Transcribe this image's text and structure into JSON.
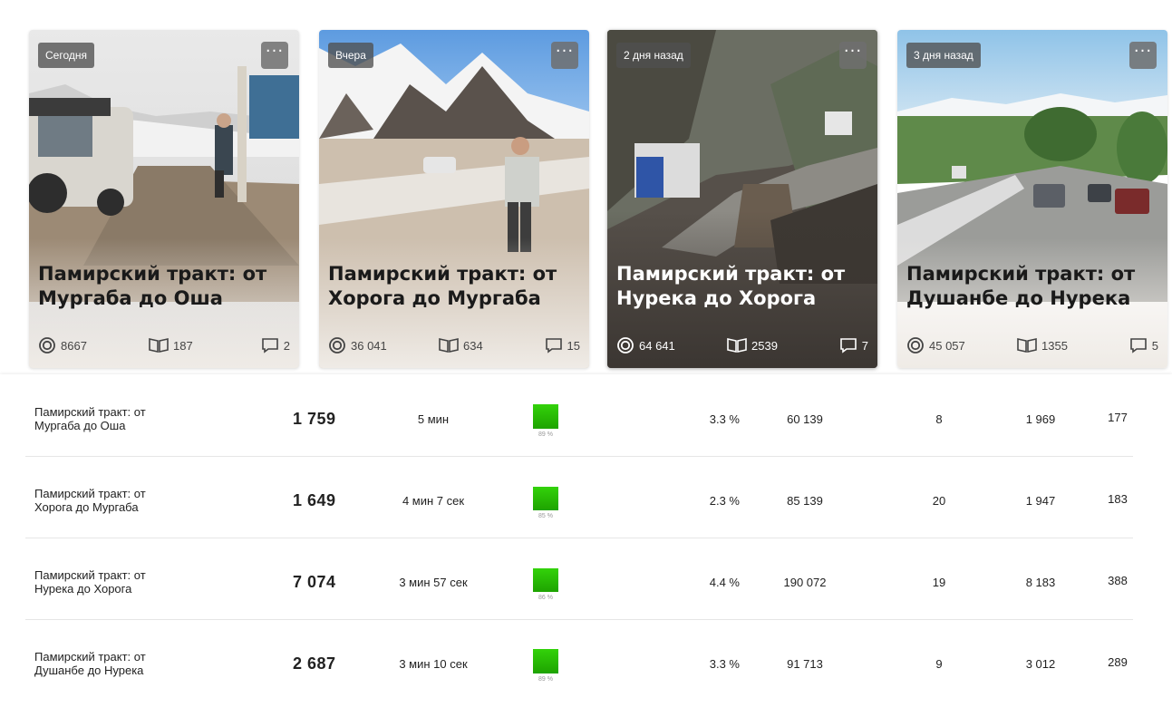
{
  "cards": [
    {
      "badge": "Сегодня",
      "title": "Памирский тракт: от Мургаба до Оша",
      "views": "8667",
      "reads": "187",
      "comments": "2"
    },
    {
      "badge": "Вчера",
      "title": "Памирский тракт: от Хорога до Мургаба",
      "views": "36 041",
      "reads": "634",
      "comments": "15"
    },
    {
      "badge": "2 дня назад",
      "title": "Памирский тракт: от Нурека до Хорога",
      "views": "64 641",
      "reads": "2539",
      "comments": "7"
    },
    {
      "badge": "3 дня назад",
      "title": "Памирский тракт: от Душанбе до Нурека",
      "views": "45 057",
      "reads": "1355",
      "comments": "5"
    }
  ],
  "more_label": "···",
  "rows": [
    {
      "title_line1": "Памирский тракт: от",
      "title_line2": "Мургаба до Оша",
      "views": "1 759",
      "time": "5 мин",
      "bar_pct": "89 %",
      "bar_value": 0.89,
      "ctr": "3.3 %",
      "shows": "60 139",
      "subs": "8",
      "clicks": "1 969",
      "last": "177"
    },
    {
      "title_line1": "Памирский тракт: от",
      "title_line2": "Хорога до Мургаба",
      "views": "1 649",
      "time": "4 мин 7 сек",
      "bar_pct": "85 %",
      "bar_value": 0.85,
      "ctr": "2.3 %",
      "shows": "85 139",
      "subs": "20",
      "clicks": "1 947",
      "last": "183"
    },
    {
      "title_line1": "Памирский тракт: от",
      "title_line2": "Нурека до Хорога",
      "views": "7 074",
      "time": "3 мин 57 сек",
      "bar_pct": "86 %",
      "bar_value": 0.86,
      "ctr": "4.4 %",
      "shows": "190 072",
      "subs": "19",
      "clicks": "8 183",
      "last": "388"
    },
    {
      "title_line1": "Памирский тракт: от",
      "title_line2": "Душанбе до Нурека",
      "views": "2 687",
      "time": "3 мин 10 сек",
      "bar_pct": "89 %",
      "bar_value": 0.89,
      "ctr": "3.3 %",
      "shows": "91 713",
      "subs": "9",
      "clicks": "3 012",
      "last": "289"
    }
  ],
  "icons": {
    "views": "eye-icon",
    "reads": "book-icon",
    "comments": "comment-icon",
    "more": "more-dots-icon"
  },
  "colors": {
    "bar": "#22b004",
    "badge_bg": "#5a5a5a"
  }
}
